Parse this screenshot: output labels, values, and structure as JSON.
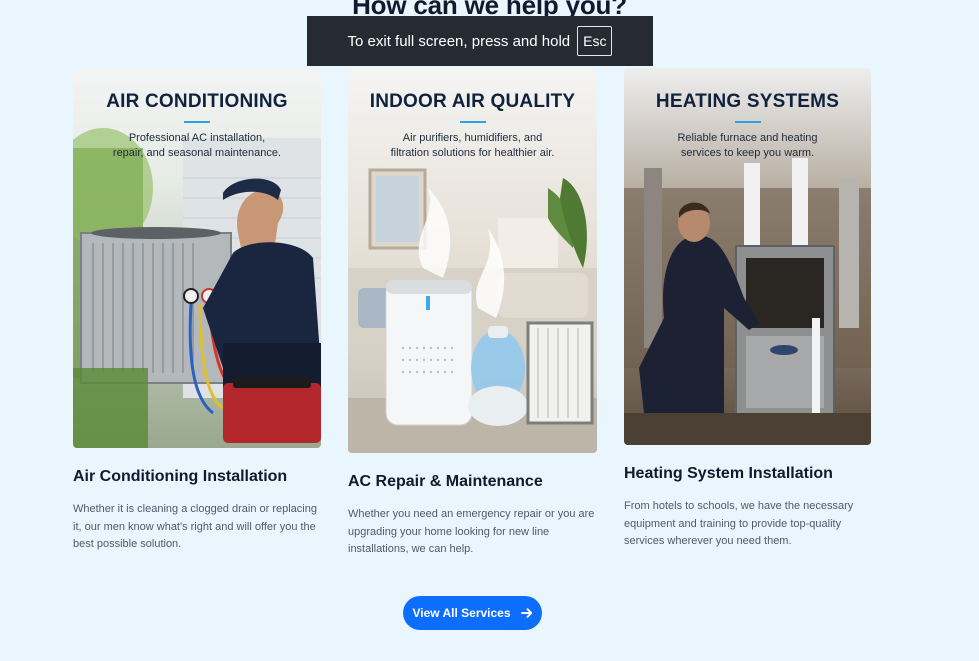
{
  "section": {
    "title": "How can we help you?"
  },
  "fullscreen_toast": {
    "message": "To exit full screen, press and hold",
    "key": "Esc"
  },
  "cards": [
    {
      "image_heading": "AIR CONDITIONING",
      "image_sub_line1": "Professional AC installation,",
      "image_sub_line2": "repair, and seasonal maintenance.",
      "title": "Air Conditioning Installation",
      "description": "Whether it is cleaning a clogged drain or replacing it, our men know what's right and will offer you the best possible solution."
    },
    {
      "image_heading": "INDOOR AIR QUALITY",
      "image_sub_line1": "Air purifiers, humidifiers, and",
      "image_sub_line2": "filtration solutions for healthier air.",
      "title": "AC Repair & Maintenance",
      "description": "Whether you need an emergency repair or you are upgrading your home looking for new line installations, we can help."
    },
    {
      "image_heading": "HEATING SYSTEMS",
      "image_sub_line1": "Reliable furnace and heating",
      "image_sub_line2": "services to keep you warm.",
      "title": "Heating System Installation",
      "description": "From hotels to schools, we have the necessary equipment and training to provide top-quality services wherever you need them."
    }
  ],
  "cta": {
    "label": "View All Services",
    "icon": "arrow-right-icon"
  },
  "colors": {
    "background": "#eaf6fe",
    "accent": "#0d6efd",
    "rule": "#2aa3e0",
    "toast": "#262a33"
  }
}
